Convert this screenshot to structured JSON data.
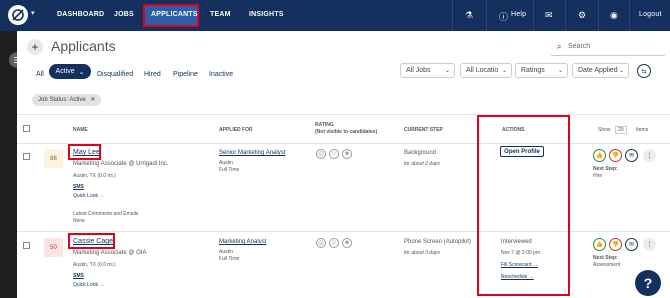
{
  "nav": {
    "links": [
      "DASHBOARD",
      "JOBS",
      "APPLICANTS",
      "TEAM",
      "INSIGHTS"
    ],
    "help": "Help",
    "logout": "Logout"
  },
  "page": {
    "title": "Applicants",
    "search_placeholder": "Search"
  },
  "filters": {
    "tabs": [
      "All",
      "Active",
      "Disqualified",
      "Hired",
      "Pipeline",
      "Inactive"
    ],
    "dropdowns": [
      "All Jobs",
      "All Locatio",
      "Ratings",
      "Date Applied"
    ],
    "chip": "Job Status: Active"
  },
  "table": {
    "headers": {
      "name": "NAME",
      "applied_for": "APPLIED FOR",
      "rating": "RATING",
      "rating_note": "(Not visible to candidates)",
      "current_step": "CURRENT STEP",
      "actions": "ACTIONS",
      "show": "Show",
      "show_count": "20",
      "items": "Items"
    },
    "rows": [
      {
        "score": "88",
        "name": "May Lee",
        "title": "Marketing Associate @ Urrigadi Inc.",
        "location": "Austin, TX (0.0 mi.)",
        "sms": "SMS",
        "quick_look": "Quick Look →",
        "comments_label": "Latest Comments and Emails",
        "comments_value": "None",
        "job": "Senior Marketing Analyst",
        "job_city": "Austin",
        "job_type": "Full Time",
        "step": "Background",
        "step_time": "for about 2 days",
        "action": "Open Profile",
        "next_label": "Next Step:",
        "next_value": "Hire"
      },
      {
        "score": "50",
        "name": "Cassie Cage",
        "title": "Marketing Associate @ OIA",
        "location": "Austin, TX (0.0 mi.)",
        "sms": "SMS",
        "quick_look": "Quick Look →",
        "job": "Marketing Analyst",
        "job_city": "Austin",
        "job_type": "Full Time",
        "step": "Phone Screen (Autopilot)",
        "step_time": "for about 3 days",
        "status": "Interviewed",
        "status_date": "Nov 7 @ 2:00 pm",
        "fill_scorecard": "Fill Scorecard →",
        "reschedule": "Reschedule →",
        "next_label": "Next Step:",
        "next_value": "Assessment"
      }
    ]
  },
  "colors": {
    "nav_bg": "#14305e",
    "nav_active": "#2d5ea8",
    "highlight": "#e3001b",
    "accent": "#14305e"
  }
}
